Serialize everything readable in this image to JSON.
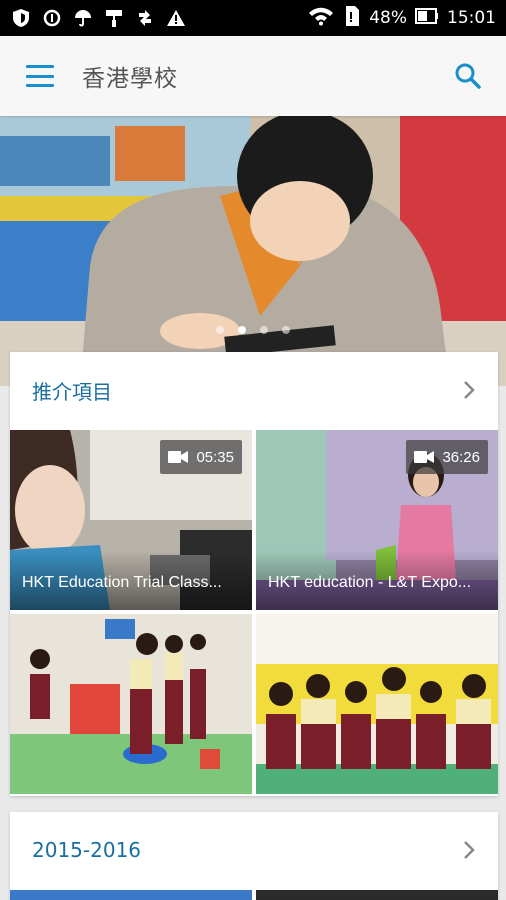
{
  "status_bar": {
    "battery": "48%",
    "time": "15:01",
    "icons": [
      "shield-icon",
      "data-saver-icon",
      "umbrella-icon",
      "paint-roller-icon",
      "sync-arrows-icon",
      "warning-icon"
    ]
  },
  "app_bar": {
    "title": "香港學校",
    "menu_icon": "menu-icon",
    "search_icon": "search-icon"
  },
  "hero": {
    "slide_count": 4,
    "active_slide": 1
  },
  "sections": [
    {
      "title": "推介項目",
      "tiles": [
        {
          "caption": "HKT Education Trial Class...",
          "duration": "05:35",
          "is_video": true
        },
        {
          "caption": "HKT education - L&T Expo...",
          "duration": "36:26",
          "is_video": true
        },
        {
          "caption": "",
          "duration": "",
          "is_video": false
        },
        {
          "caption": "",
          "duration": "",
          "is_video": false
        }
      ]
    },
    {
      "title": "2015-2016"
    }
  ],
  "colors": {
    "accent": "#1a8fc9",
    "section_title": "#1a6fa0",
    "app_bar_bg": "#f7f7f7",
    "page_bg": "#e9e9e9"
  }
}
